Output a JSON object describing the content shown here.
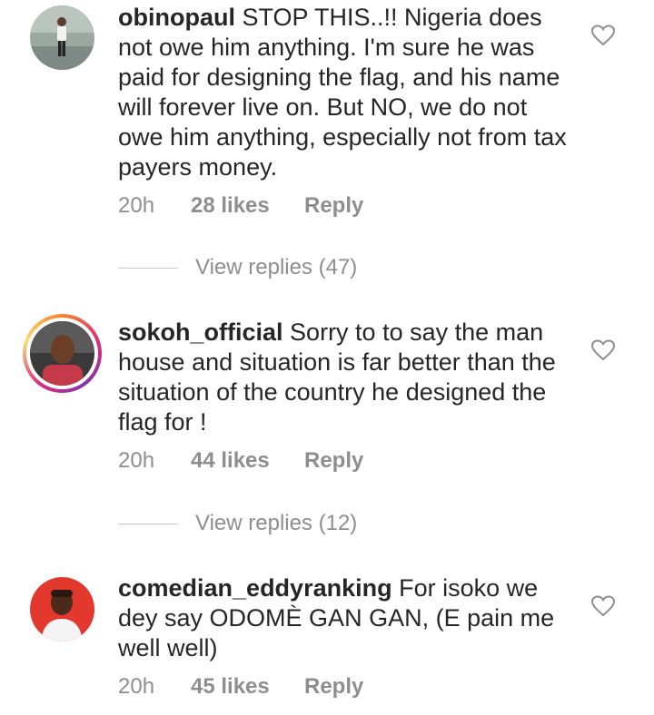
{
  "comments": [
    {
      "username": "obinopaul",
      "text": " STOP THIS..!! Nigeria does not owe him anything. I'm sure he was paid for designing the flag, and his name will forever live on. But NO, we do not owe him anything, especially not from tax payers money.",
      "time": "20h",
      "likes": "28 likes",
      "reply": "Reply",
      "view_replies": "View replies (47)",
      "avatar_icon": "user-photo-standing"
    },
    {
      "username": "sokoh_official",
      "text": " Sorry to to say the man house and situation is far better than the situation of the country he designed the flag for !",
      "time": "20h",
      "likes": "44 likes",
      "reply": "Reply",
      "view_replies": "View replies (12)",
      "avatar_icon": "user-photo-portrait-story-ring"
    },
    {
      "username": "comedian_eddyranking",
      "text": " For isoko we dey say ODOMÈ GAN GAN, (E pain me well well)",
      "time": "20h",
      "likes": "45 likes",
      "reply": "Reply",
      "avatar_icon": "user-photo-portrait"
    }
  ],
  "colors": {
    "text": "#262626",
    "meta": "#8e8e8e",
    "divider": "#c7c7c7"
  }
}
